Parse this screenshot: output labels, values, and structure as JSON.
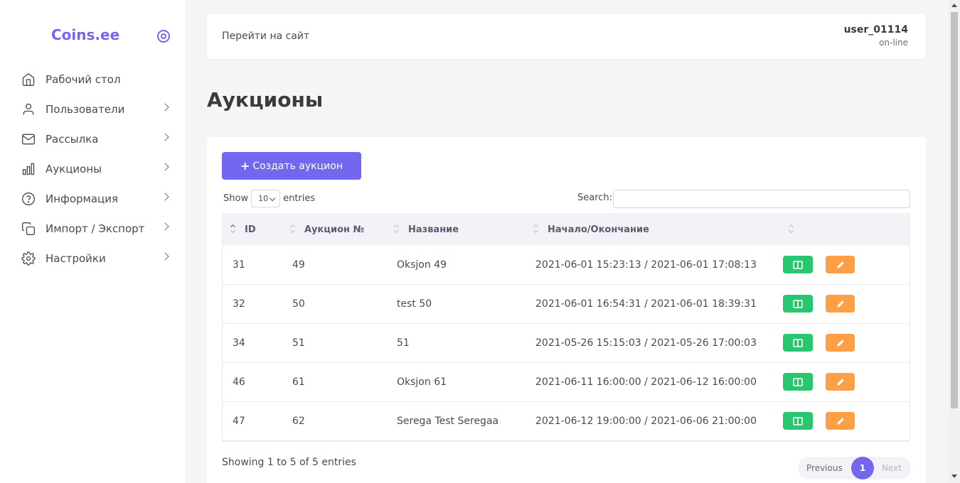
{
  "brand": {
    "name": "Coins.ee",
    "accent": "#7367f0"
  },
  "sidebar": {
    "items": [
      {
        "label": "Рабочий стол",
        "icon": "home-icon"
      },
      {
        "label": "Пользователи",
        "icon": "user-icon"
      },
      {
        "label": "Рассылка",
        "icon": "mail-icon"
      },
      {
        "label": "Аукционы",
        "icon": "bar-chart-icon"
      },
      {
        "label": "Информация",
        "icon": "help-circle-icon"
      },
      {
        "label": "Импорт / Экспорт",
        "icon": "copy-icon"
      },
      {
        "label": "Настройки",
        "icon": "settings-icon"
      }
    ]
  },
  "header": {
    "site_link": "Перейти на сайт",
    "username": "user_01114",
    "status": "on-line"
  },
  "page": {
    "title": "Аукционы"
  },
  "toolbar": {
    "create_label": "Создать аукцион"
  },
  "table_controls": {
    "show_label": "Show",
    "length_value": "10",
    "entries_label": "entries",
    "search_label": "Search:"
  },
  "table": {
    "columns": [
      "ID",
      "Аукцион №",
      "Название",
      "Начало/Окончание",
      ""
    ],
    "rows": [
      {
        "id": "31",
        "number": "49",
        "name": "Oksjon 49",
        "period": "2021-06-01 15:23:13 / 2021-06-01 17:08:13"
      },
      {
        "id": "32",
        "number": "50",
        "name": "test 50",
        "period": "2021-06-01 16:54:31 / 2021-06-01 18:39:31"
      },
      {
        "id": "34",
        "number": "51",
        "name": "51",
        "period": "2021-05-26 15:15:03 / 2021-05-26 17:00:03"
      },
      {
        "id": "46",
        "number": "61",
        "name": "Oksjon 61",
        "period": "2021-06-11 16:00:00 / 2021-06-12 16:00:00"
      },
      {
        "id": "47",
        "number": "62",
        "name": "Serega Test Seregaa",
        "period": "2021-06-12 19:00:00 / 2021-06-06 21:00:00"
      }
    ]
  },
  "footer": {
    "info": "Showing 1 to 5 of 5 entries"
  },
  "pagination": {
    "previous": "Previous",
    "page": "1",
    "next": "Next"
  },
  "colors": {
    "view_button": "#28c76f",
    "edit_button": "#ff9f43"
  }
}
